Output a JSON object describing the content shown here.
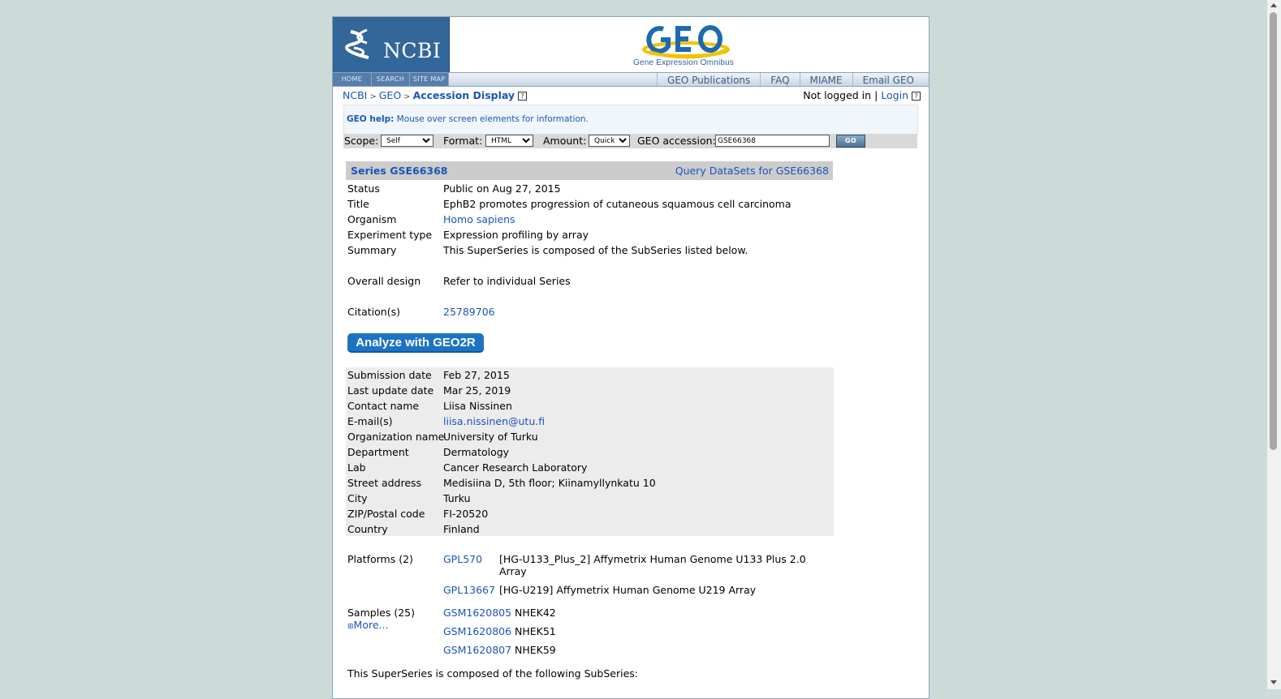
{
  "header": {
    "ncbi_logo_text": "NCBI",
    "geo_logo_text": "GEO",
    "geo_subtitle": "Gene Expression Omnibus",
    "small_nav": [
      "HOME",
      "SEARCH",
      "SITE MAP"
    ],
    "top_links": [
      "GEO Publications",
      "FAQ",
      "MIAME",
      "Email GEO"
    ]
  },
  "breadcrumb": {
    "ncbi": "NCBI",
    "geo": "GEO",
    "current": "Accession Display",
    "sep": ">"
  },
  "login": {
    "status": "Not logged in",
    "sep": "|",
    "login": "Login"
  },
  "help": {
    "label": "GEO help:",
    "text": "Mouse over screen elements for information."
  },
  "form": {
    "scope_label": "Scope:",
    "scope_value": "Self",
    "format_label": "Format:",
    "format_value": "HTML",
    "amount_label": "Amount:",
    "amount_value": "Quick",
    "accession_label": "GEO accession:",
    "accession_value": "GSE66368",
    "go_label": "GO"
  },
  "series": {
    "title": "Series GSE66368",
    "query_link": "Query DataSets for GSE66368",
    "fields": [
      {
        "key": "Status",
        "value": "Public on Aug 27, 2015"
      },
      {
        "key": "Title",
        "value": "EphB2 promotes progression of cutaneous squamous cell carcinoma"
      },
      {
        "key": "Organism",
        "value": "Homo sapiens"
      },
      {
        "key": "Experiment type",
        "value": "Expression profiling by array"
      },
      {
        "key": "Summary",
        "value": "This SuperSeries is composed of the SubSeries listed below."
      },
      {
        "key": "Overall design",
        "value": "Refer to individual Series"
      },
      {
        "key": "Citation(s)",
        "value": "25789706"
      }
    ],
    "analyze_button": "Analyze with GEO2R",
    "contact": [
      {
        "key": "Submission date",
        "value": "Feb 27, 2015"
      },
      {
        "key": "Last update date",
        "value": "Mar 25, 2019"
      },
      {
        "key": "Contact name",
        "value": "Liisa Nissinen"
      },
      {
        "key": "E-mail(s)",
        "value": "liisa.nissinen@utu.fi"
      },
      {
        "key": "Organization name",
        "value": "University of Turku"
      },
      {
        "key": "Department",
        "value": "Dermatology"
      },
      {
        "key": "Lab",
        "value": "Cancer Research Laboratory"
      },
      {
        "key": "Street address",
        "value": "Medisiina D, 5th floor; Kiinamyllynkatu 10"
      },
      {
        "key": "City",
        "value": "Turku"
      },
      {
        "key": "ZIP/Postal code",
        "value": "FI-20520"
      },
      {
        "key": "Country",
        "value": "Finland"
      }
    ],
    "platforms_label": "Platforms (2)",
    "platforms": [
      {
        "id": "GPL570",
        "desc_line1": "[HG-U133_Plus_2] Affymetrix Human Genome U133 Plus 2.0",
        "desc_line2": "Array"
      },
      {
        "id": "GPL13667",
        "desc_line1": "[HG-U219] Affymetrix Human Genome U219 Array",
        "desc_line2": ""
      }
    ],
    "samples_label": "Samples (25)",
    "more_label": "More...",
    "samples": [
      {
        "id": "GSM1620805",
        "name": "NHEK42"
      },
      {
        "id": "GSM1620806",
        "name": "NHEK51"
      },
      {
        "id": "GSM1620807",
        "name": "NHEK59"
      }
    ],
    "subseries_text": "This SuperSeries is composed of the following SubSeries:"
  }
}
